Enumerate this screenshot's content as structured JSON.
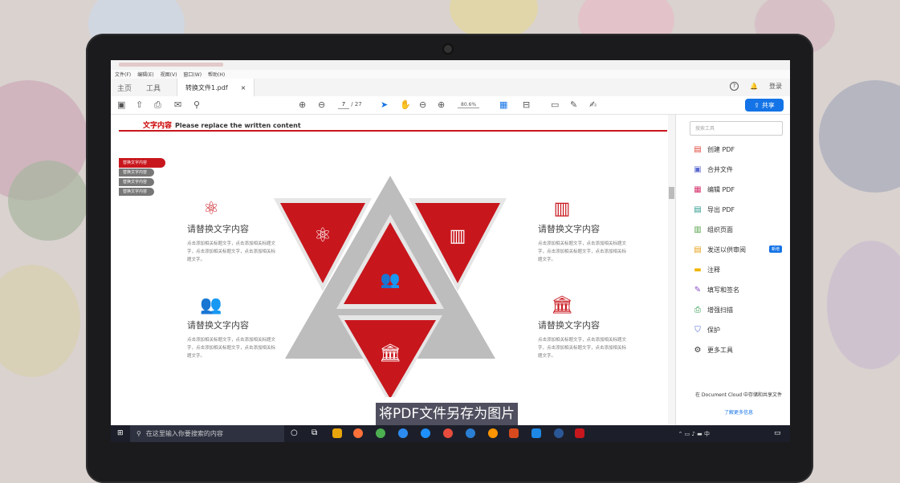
{
  "menu": [
    "文件(F)",
    "编辑(E)",
    "视图(V)",
    "窗口(W)",
    "帮助(H)"
  ],
  "tabs": {
    "home": "主页",
    "tools": "工具",
    "doc_tab": "转换文件1.pdf",
    "close": "×",
    "login": "登录"
  },
  "toolbar": {
    "page_current": "7",
    "page_total": "/ 27",
    "zoom": "80.6%",
    "share": "共享"
  },
  "slide": {
    "heading_cn": "文字内容",
    "heading_en": "Please replace the written content",
    "side_tabs": [
      "替换文字内容",
      "替换文字内容",
      "替换文字内容",
      "替换文字内容"
    ],
    "items": [
      {
        "title": "请替换文字内容",
        "desc": "点击添加相关标题文字，点击添加相关标题文字，点击添加相关标题文字，点击添加相关标题文字。"
      },
      {
        "title": "请替换文字内容",
        "desc": "点击添加相关标题文字，点击添加相关标题文字，点击添加相关标题文字，点击添加相关标题文字。"
      },
      {
        "title": "请替换文字内容",
        "desc": "点击添加相关标题文字，点击添加相关标题文字，点击添加相关标题文字，点击添加相关标题文字。"
      },
      {
        "title": "请替换文字内容",
        "desc": "点击添加相关标题文字，点击添加相关标题文字，点击添加相关标题文字，点击添加相关标题文字。"
      }
    ]
  },
  "right_panel": {
    "search_placeholder": "搜索工具",
    "tools": [
      {
        "label": "创建 PDF",
        "icon": "create-pdf-icon",
        "color": "#e0483e"
      },
      {
        "label": "合并文件",
        "icon": "combine-files-icon",
        "color": "#5b6ad0"
      },
      {
        "label": "编辑 PDF",
        "icon": "edit-pdf-icon",
        "color": "#d6336c"
      },
      {
        "label": "导出 PDF",
        "icon": "export-pdf-icon",
        "color": "#2d9a8c"
      },
      {
        "label": "组织页面",
        "icon": "organize-pages-icon",
        "color": "#56a34a"
      },
      {
        "label": "发送以供审阅",
        "icon": "send-review-icon",
        "color": "#e6a117"
      },
      {
        "label": "注释",
        "icon": "comment-icon",
        "color": "#f0b400"
      },
      {
        "label": "填写和签名",
        "icon": "fill-sign-icon",
        "color": "#8b4fc7"
      },
      {
        "label": "增强扫描",
        "icon": "enhance-scan-icon",
        "color": "#2d9a4a"
      },
      {
        "label": "保护",
        "icon": "protect-icon",
        "color": "#4b5fc7"
      },
      {
        "label": "更多工具",
        "icon": "more-tools-icon",
        "color": "#333333"
      }
    ],
    "new_badge": "新增",
    "cloud_text": "在 Document Cloud 中存储和共享文件",
    "learn_more": "了解更多信息"
  },
  "taskbar": {
    "search_placeholder": "在这里输入你要搜索的内容",
    "ime": "中"
  },
  "subtitle": "将PDF文件另存为图片",
  "colors": {
    "accent": "#c8161d",
    "share_blue": "#1473e6"
  }
}
